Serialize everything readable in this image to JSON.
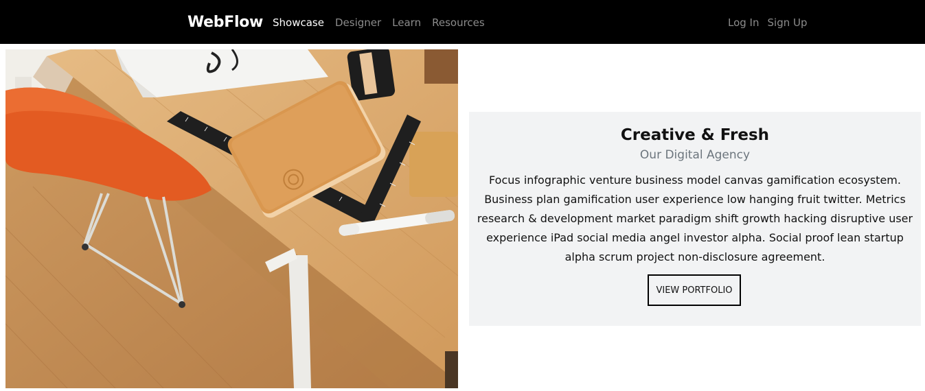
{
  "nav": {
    "brand": "WebFlow",
    "links": [
      "Showcase",
      "Designer",
      "Learn",
      "Resources"
    ],
    "right_links": [
      "Log In",
      "Sign Up"
    ]
  },
  "hero_image": {
    "alt": "Wooden desk with orange chair, leather notebook, rulers and marker"
  },
  "card": {
    "title": "Creative & Fresh",
    "subtitle": "Our Digital Agency",
    "body": "Focus infographic venture business model canvas gamification ecosystem. Business plan gamification user experience low hanging fruit twitter. Metrics research & development market paradigm shift growth hacking disruptive user experience iPad social media angel investor alpha. Social proof lean startup alpha scrum project non-disclosure agreement.",
    "button_label": "VIEW PORTFOLIO"
  },
  "colors": {
    "navbar_bg": "#000000",
    "card_bg": "#f2f3f4",
    "link_muted": "#8c8c8c"
  }
}
